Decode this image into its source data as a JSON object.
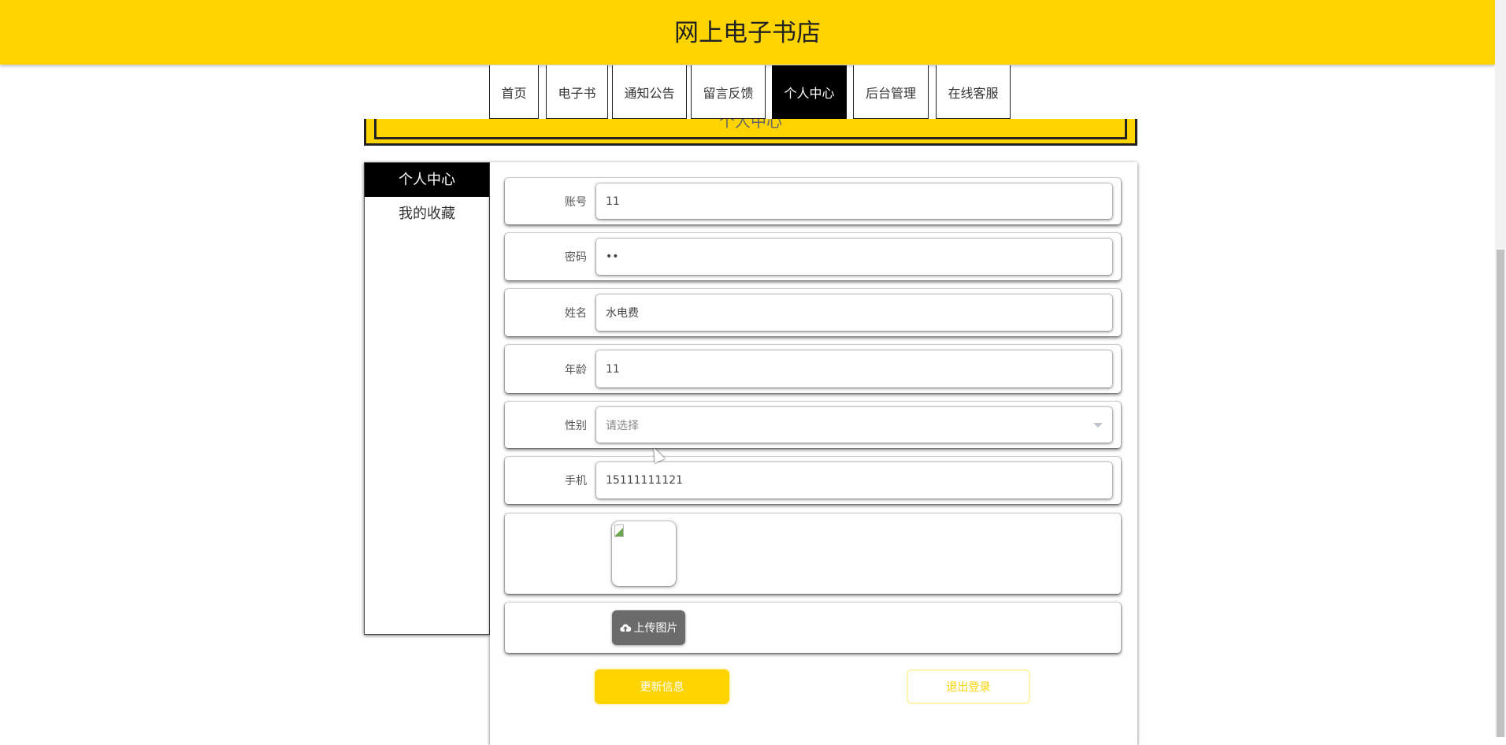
{
  "header": {
    "title": "网上电子书店"
  },
  "nav": [
    {
      "label": "首页"
    },
    {
      "label": "电子书"
    },
    {
      "label": "通知公告"
    },
    {
      "label": "留言反馈"
    },
    {
      "label": "个人中心",
      "active": true
    },
    {
      "label": "后台管理"
    },
    {
      "label": "在线客服"
    }
  ],
  "banner": {
    "title": "个人中心"
  },
  "sidebar": {
    "items": [
      {
        "label": "个人中心"
      },
      {
        "label": "我的收藏"
      }
    ]
  },
  "form": {
    "account": {
      "label": "账号",
      "value": "11"
    },
    "password": {
      "label": "密码",
      "value": "••"
    },
    "name": {
      "label": "姓名",
      "value": "水电费"
    },
    "age": {
      "label": "年龄",
      "value": "11"
    },
    "gender": {
      "label": "性别",
      "placeholder": "请选择"
    },
    "phone": {
      "label": "手机",
      "value": "15111111121"
    },
    "upload_label": "上传图片"
  },
  "actions": {
    "update": "更新信息",
    "logout": "退出登录"
  },
  "colors": {
    "brand": "#fdd300",
    "dark": "#000000"
  }
}
